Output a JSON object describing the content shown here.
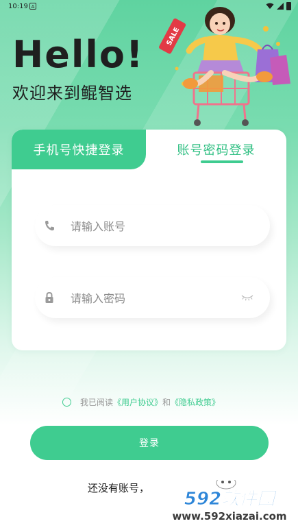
{
  "status_bar": {
    "time": "10:19",
    "notification_badge": "A"
  },
  "header": {
    "hello": "Hello!",
    "welcome": "欢迎来到鲲智选",
    "sale_tag": "SALE"
  },
  "tabs": {
    "quick_login": "手机号快捷登录",
    "password_login": "账号密码登录"
  },
  "form": {
    "account_placeholder": "请输入账号",
    "password_placeholder": "请输入密码"
  },
  "agreement": {
    "prefix": "我已阅读",
    "user_agreement": "《用户协议》",
    "and": "和",
    "privacy_policy": "《隐私政策》"
  },
  "login_button": "登录",
  "register": {
    "prompt": "还没有账号，",
    "link": ""
  },
  "watermark": {
    "brand": "592软件园",
    "url": "www.592xiazai.com"
  },
  "colors": {
    "accent": "#3fcc90",
    "text": "#1f1f1f"
  }
}
